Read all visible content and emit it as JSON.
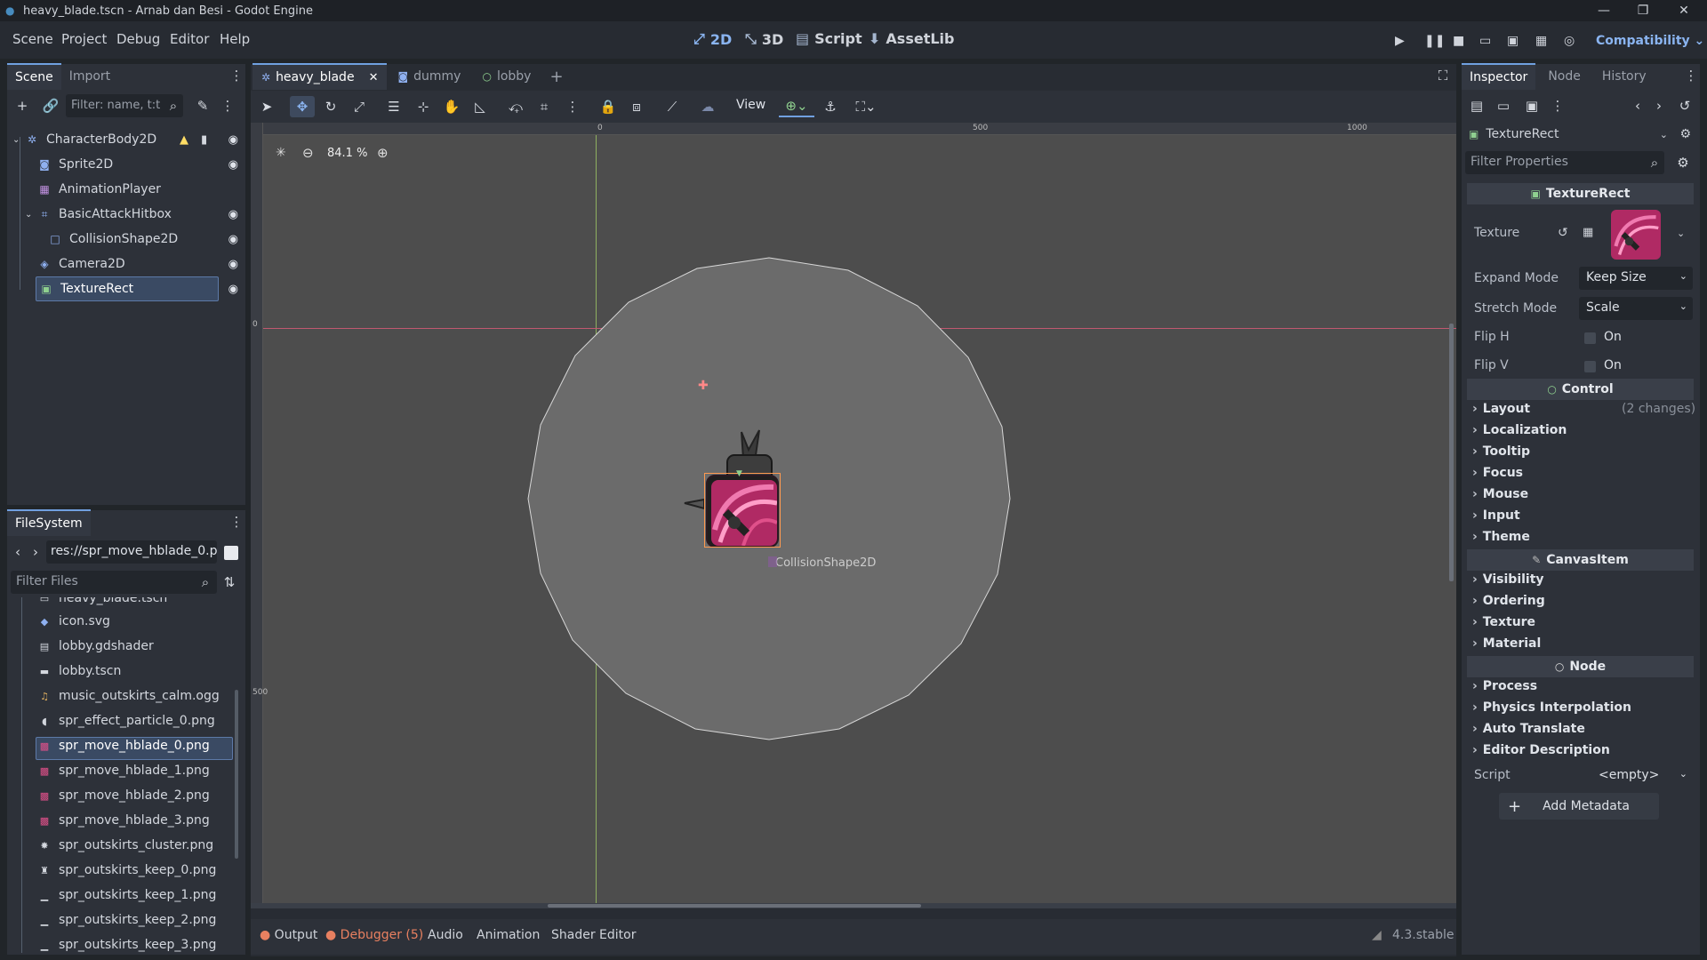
{
  "window": {
    "title": "heavy_blade.tscn - Arnab dan Besi - Godot Engine"
  },
  "menu": [
    "Scene",
    "Project",
    "Debug",
    "Editor",
    "Help"
  ],
  "main_screens": [
    {
      "label": "2D",
      "icon": "2d-icon",
      "active": true
    },
    {
      "label": "3D",
      "icon": "3d-icon"
    },
    {
      "label": "Script",
      "icon": "script-icon"
    },
    {
      "label": "AssetLib",
      "icon": "assetlib-icon"
    }
  ],
  "renderer": "Compatibility",
  "scene_dock": {
    "tabs": [
      "Scene",
      "Import"
    ],
    "filter_placeholder": "Filter: name, t:t",
    "nodes": [
      {
        "label": "CharacterBody2D",
        "icon": "characterbody2d-icon",
        "depth": 0,
        "warning": true
      },
      {
        "label": "Sprite2D",
        "icon": "sprite2d-icon",
        "depth": 1
      },
      {
        "label": "AnimationPlayer",
        "icon": "animationplayer-icon",
        "depth": 1
      },
      {
        "label": "BasicAttackHitbox",
        "icon": "area2d-icon",
        "depth": 1
      },
      {
        "label": "CollisionShape2D",
        "icon": "collisionshape2d-icon",
        "depth": 2
      },
      {
        "label": "Camera2D",
        "icon": "camera2d-icon",
        "depth": 1
      },
      {
        "label": "TextureRect",
        "icon": "texturerect-icon",
        "depth": 1,
        "selected": true
      }
    ]
  },
  "filesystem": {
    "title": "FileSystem",
    "path": "res://spr_move_hblade_0.p",
    "filter_placeholder": "Filter Files",
    "files": [
      {
        "name": "heavy_blade.tscn",
        "icon": "scene-icon"
      },
      {
        "name": "icon.svg",
        "icon": "svg-icon"
      },
      {
        "name": "lobby.gdshader",
        "icon": "shader-icon"
      },
      {
        "name": "lobby.tscn",
        "icon": "scene-icon"
      },
      {
        "name": "music_outskirts_calm.ogg",
        "icon": "audio-icon"
      },
      {
        "name": "spr_effect_particle_0.png",
        "icon": "image-icon"
      },
      {
        "name": "spr_move_hblade_0.png",
        "icon": "image-icon",
        "selected": true
      },
      {
        "name": "spr_move_hblade_1.png",
        "icon": "image-icon"
      },
      {
        "name": "spr_move_hblade_2.png",
        "icon": "image-icon"
      },
      {
        "name": "spr_move_hblade_3.png",
        "icon": "image-icon"
      },
      {
        "name": "spr_outskirts_cluster.png",
        "icon": "image-icon"
      },
      {
        "name": "spr_outskirts_keep_0.png",
        "icon": "image-icon"
      },
      {
        "name": "spr_outskirts_keep_1.png",
        "icon": "image-icon"
      },
      {
        "name": "spr_outskirts_keep_2.png",
        "icon": "image-icon"
      },
      {
        "name": "spr_outskirts_keep_3.png",
        "icon": "image-icon"
      }
    ]
  },
  "editor_tabs": [
    {
      "label": "heavy_blade",
      "active": true
    },
    {
      "label": "dummy"
    },
    {
      "label": "lobby"
    }
  ],
  "toolbar": {
    "view_label": "View"
  },
  "viewport": {
    "zoom": "84.1 %",
    "ruler_labels": [
      "0",
      "500",
      "1000"
    ],
    "vruler_labels": [
      "0",
      "500"
    ],
    "collision_label": "CollisionShape2D"
  },
  "bottom_panel": {
    "tabs": [
      "Output",
      "Debugger (5)",
      "Audio",
      "Animation",
      "Shader Editor"
    ],
    "version": "4.3.stable"
  },
  "inspector": {
    "tabs": [
      "Inspector",
      "Node",
      "History"
    ],
    "object": "TextureRect",
    "filter_placeholder": "Filter Properties",
    "class_header": "TextureRect",
    "texture_label": "Texture",
    "expand_mode": {
      "label": "Expand Mode",
      "value": "Keep Size"
    },
    "stretch_mode": {
      "label": "Stretch Mode",
      "value": "Scale"
    },
    "flip_h": {
      "label": "Flip H",
      "value": "On"
    },
    "flip_v": {
      "label": "Flip V",
      "value": "On"
    },
    "control_header": "Control",
    "control_sections": [
      "Layout",
      "Localization",
      "Tooltip",
      "Focus",
      "Mouse",
      "Input",
      "Theme"
    ],
    "layout_changes": "(2 changes)",
    "canvasitem_header": "CanvasItem",
    "canvasitem_sections": [
      "Visibility",
      "Ordering",
      "Texture",
      "Material"
    ],
    "node_header": "Node",
    "node_sections": [
      "Process",
      "Physics Interpolation",
      "Auto Translate",
      "Editor Description"
    ],
    "script": {
      "label": "Script",
      "value": "<empty>"
    },
    "add_metadata": "Add Metadata"
  },
  "colors": {
    "accent": "#70a0e0",
    "warning": "#ffdd65",
    "debugger": "#e88060",
    "texture_pink": "#e0508a"
  }
}
